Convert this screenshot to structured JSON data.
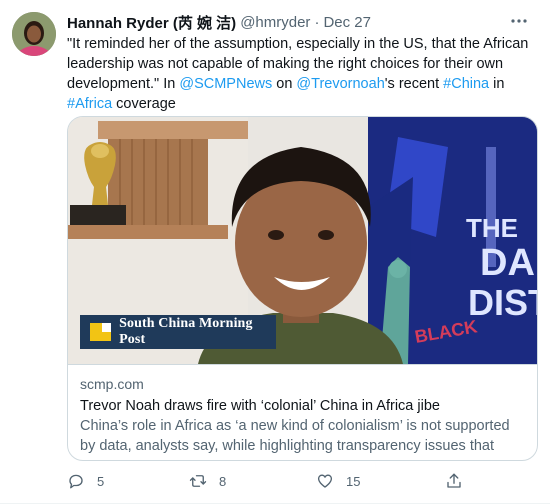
{
  "tweet": {
    "author": {
      "display_name": "Hannah Ryder (芮 婉 洁)",
      "handle": "@hmryder",
      "separator": "·",
      "date": "Dec 27"
    },
    "text_parts": [
      {
        "text": "\"It reminded her of the assumption, especially in the US, that the African leadership was not capable of making the right choices for their own development.\" In ",
        "link": false
      },
      {
        "text": "@SCMPNews",
        "link": true
      },
      {
        "text": " on ",
        "link": false
      },
      {
        "text": "@Trevornoah",
        "link": true
      },
      {
        "text": "'s recent ",
        "link": false
      },
      {
        "text": "#China",
        "link": true
      },
      {
        "text": " in ",
        "link": false
      },
      {
        "text": "#Africa",
        "link": true
      },
      {
        "text": " coverage",
        "link": false
      }
    ],
    "card": {
      "brand_overlay": "South China Morning Post",
      "domain": "scmp.com",
      "title": "Trevor Noah draws fire with ‘colonial’ China in Africa jibe",
      "description": "China’s role in Africa as ‘a new kind of colonialism’ is not supported by data, analysts say, while highlighting transparency issues that help fue...",
      "backdrop_text": [
        "THE",
        "DA",
        "DIST",
        "BLACK"
      ]
    },
    "actions": {
      "replies": "5",
      "retweets": "8",
      "likes": "15"
    },
    "icons": [
      "more-icon",
      "reply-icon",
      "retweet-icon",
      "like-icon",
      "share-icon"
    ],
    "colors": {
      "link": "#1d9bf0",
      "secondary_text": "#536471",
      "border": "#cfd9de",
      "brand_bar": "#1f3a5a",
      "brand_logo": "#f2c414"
    }
  }
}
